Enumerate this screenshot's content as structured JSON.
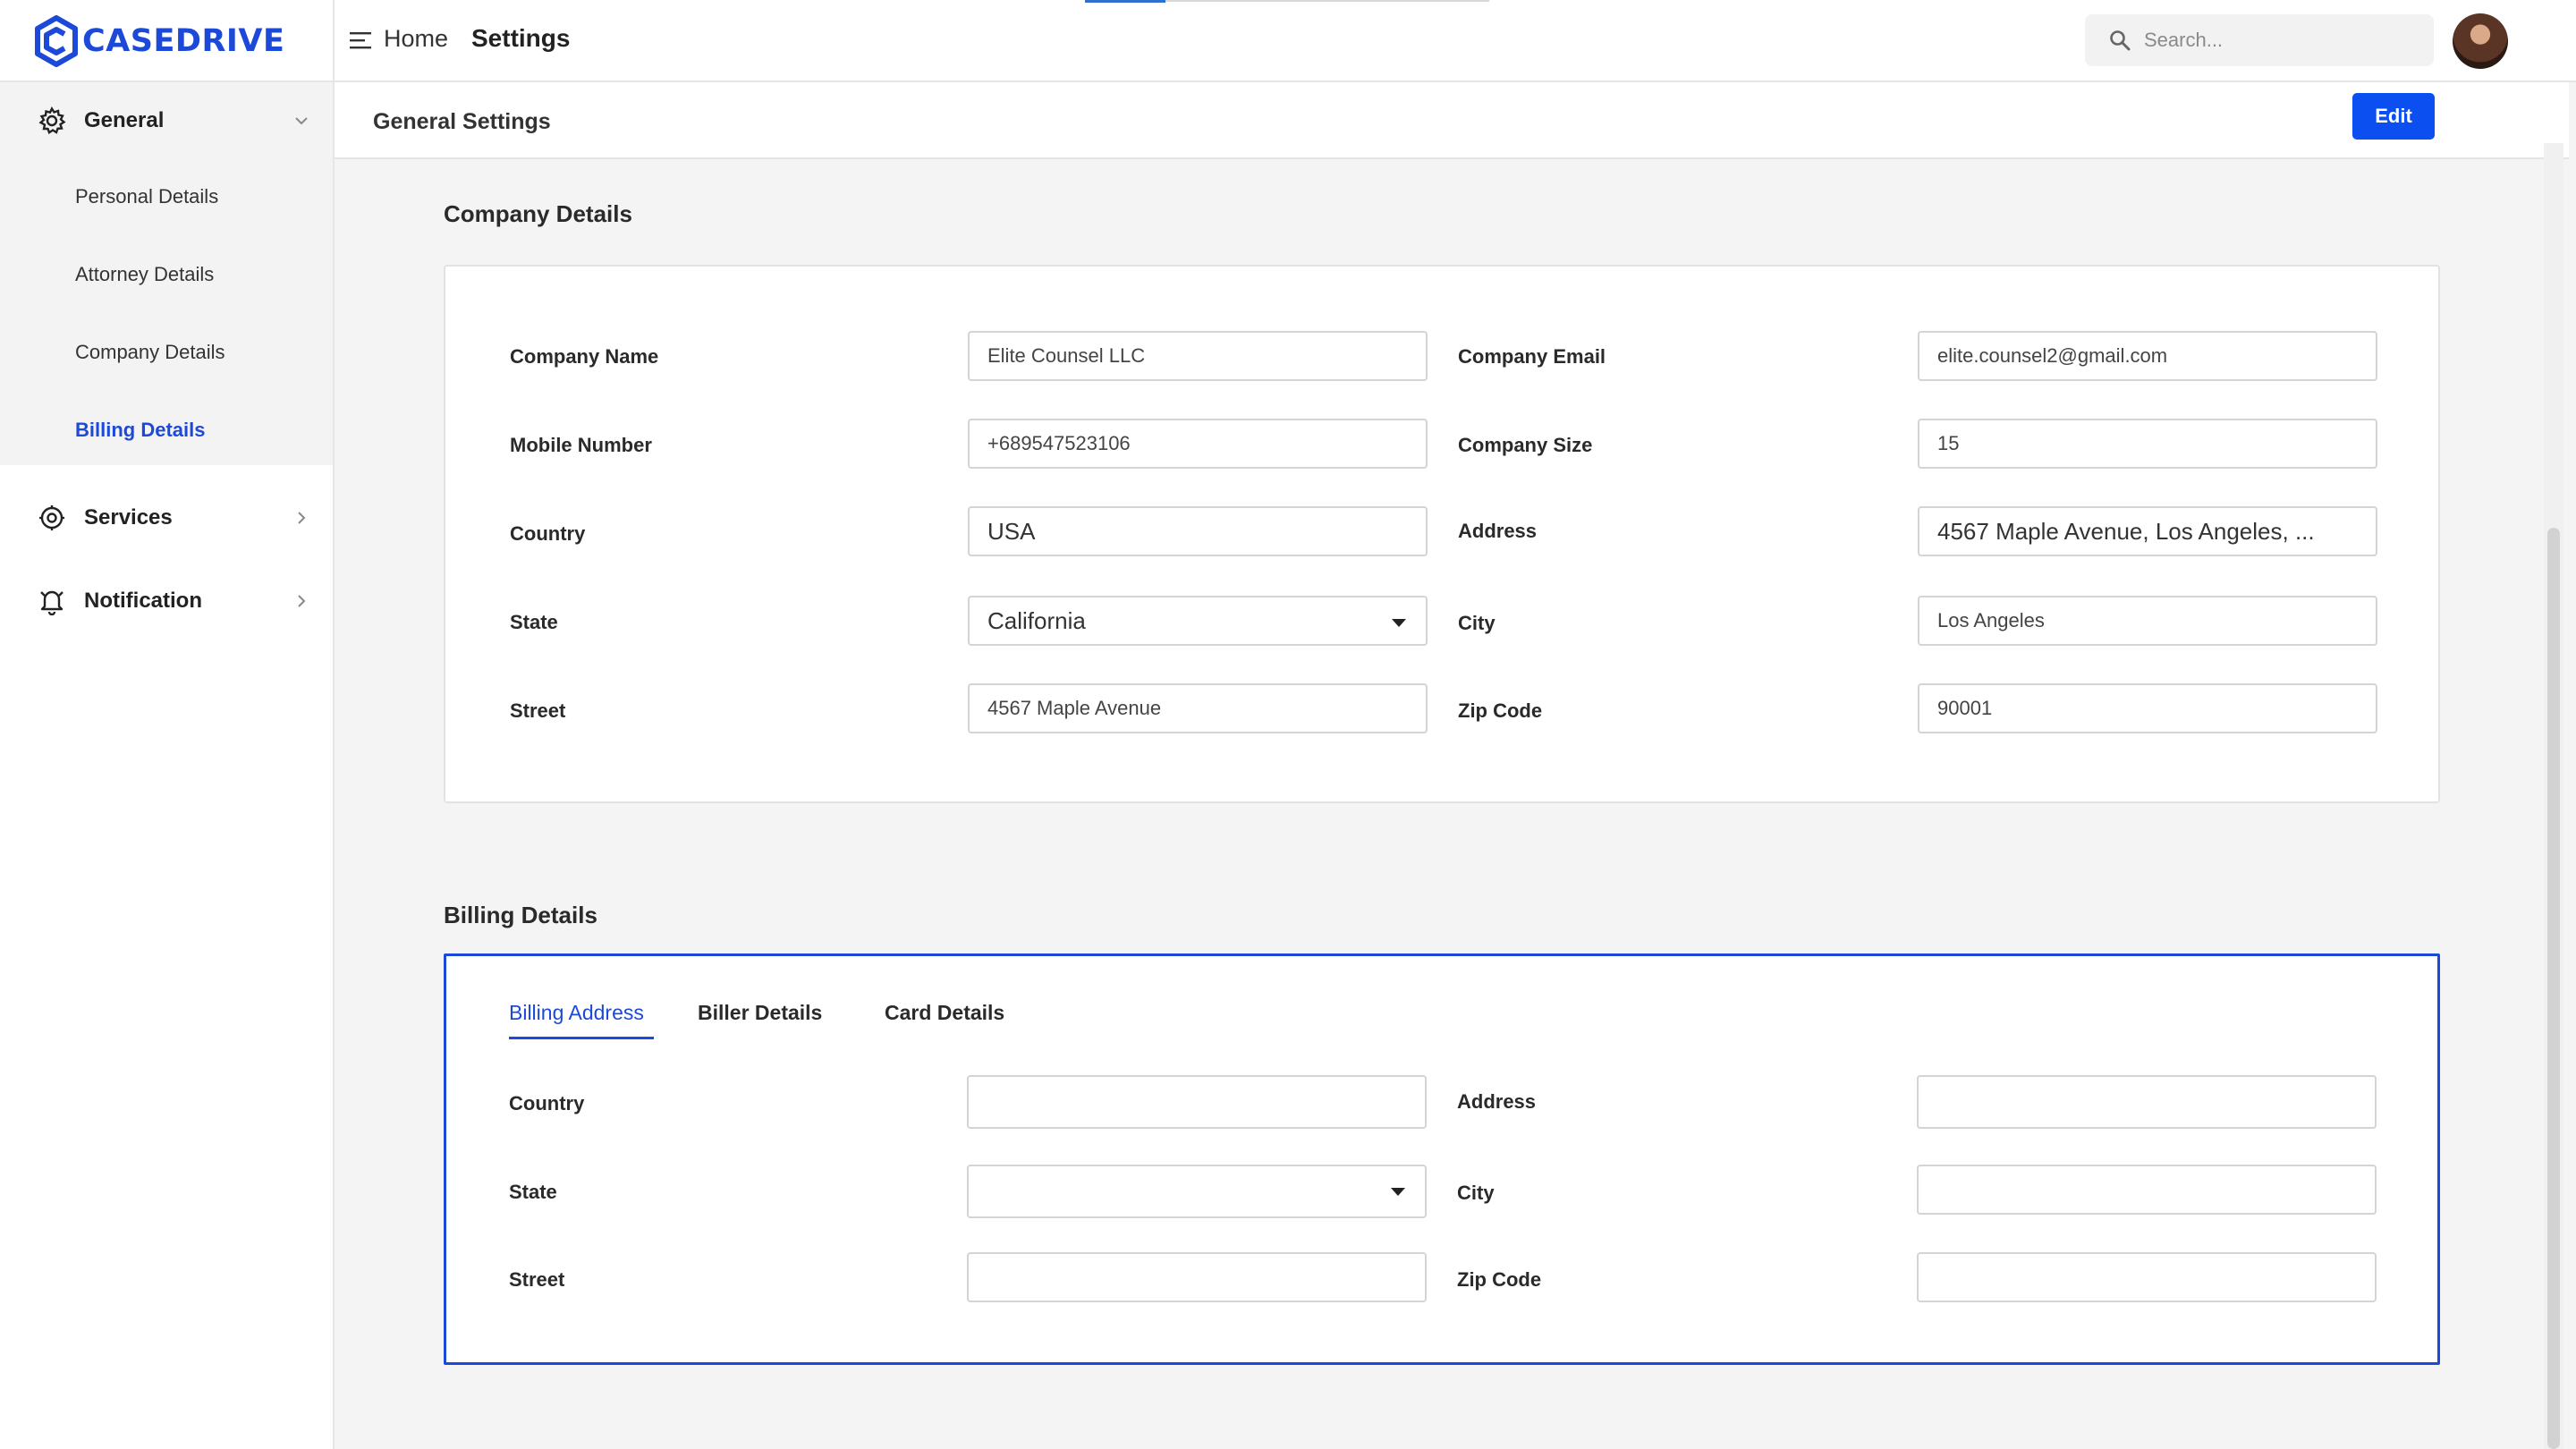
{
  "brand": {
    "name": "CASEDRIVE",
    "color": "#1d49d8"
  },
  "topbar": {
    "breadcrumb_home": "Home",
    "breadcrumb_current": "Settings",
    "search_placeholder": "Search..."
  },
  "sidebar": {
    "general": {
      "label": "General",
      "icon": "gear-icon",
      "items": [
        {
          "label": "Personal Details",
          "active": false
        },
        {
          "label": "Attorney Details",
          "active": false
        },
        {
          "label": "Company Details",
          "active": false
        },
        {
          "label": "Billing Details",
          "active": true
        }
      ]
    },
    "services": {
      "label": "Services",
      "icon": "settings-cog-icon"
    },
    "notification": {
      "label": "Notification",
      "icon": "bell-icon"
    }
  },
  "header": {
    "title": "General Settings",
    "edit_label": "Edit"
  },
  "company": {
    "section_title": "Company Details",
    "fields": {
      "company_name": {
        "label": "Company Name",
        "value": "Elite Counsel LLC"
      },
      "company_email": {
        "label": "Company Email",
        "value": "elite.counsel2@gmail.com"
      },
      "mobile_number": {
        "label": "Mobile Number",
        "value": "+689547523106"
      },
      "company_size": {
        "label": "Company Size",
        "value": "15"
      },
      "country": {
        "label": "Country",
        "value": "USA"
      },
      "address": {
        "label": "Address",
        "value": "4567 Maple Avenue, Los Angeles, ..."
      },
      "state": {
        "label": "State",
        "value": "California"
      },
      "city": {
        "label": "City",
        "value": "Los Angeles"
      },
      "street": {
        "label": "Street",
        "value": "4567 Maple Avenue"
      },
      "zip_code": {
        "label": "Zip Code",
        "value": "90001"
      }
    }
  },
  "billing": {
    "section_title": "Billing Details",
    "tabs": [
      {
        "label": "Billing Address",
        "active": true
      },
      {
        "label": "Biller Details",
        "active": false
      },
      {
        "label": "Card Details",
        "active": false
      }
    ],
    "fields": {
      "country": {
        "label": "Country",
        "value": ""
      },
      "address": {
        "label": "Address",
        "value": ""
      },
      "state": {
        "label": "State",
        "value": ""
      },
      "city": {
        "label": "City",
        "value": ""
      },
      "street": {
        "label": "Street",
        "value": ""
      },
      "zip_code": {
        "label": "Zip Code",
        "value": ""
      }
    }
  },
  "colors": {
    "accent": "#1d49d8",
    "button": "#0b4ff0",
    "page_bg": "#f4f4f4"
  }
}
